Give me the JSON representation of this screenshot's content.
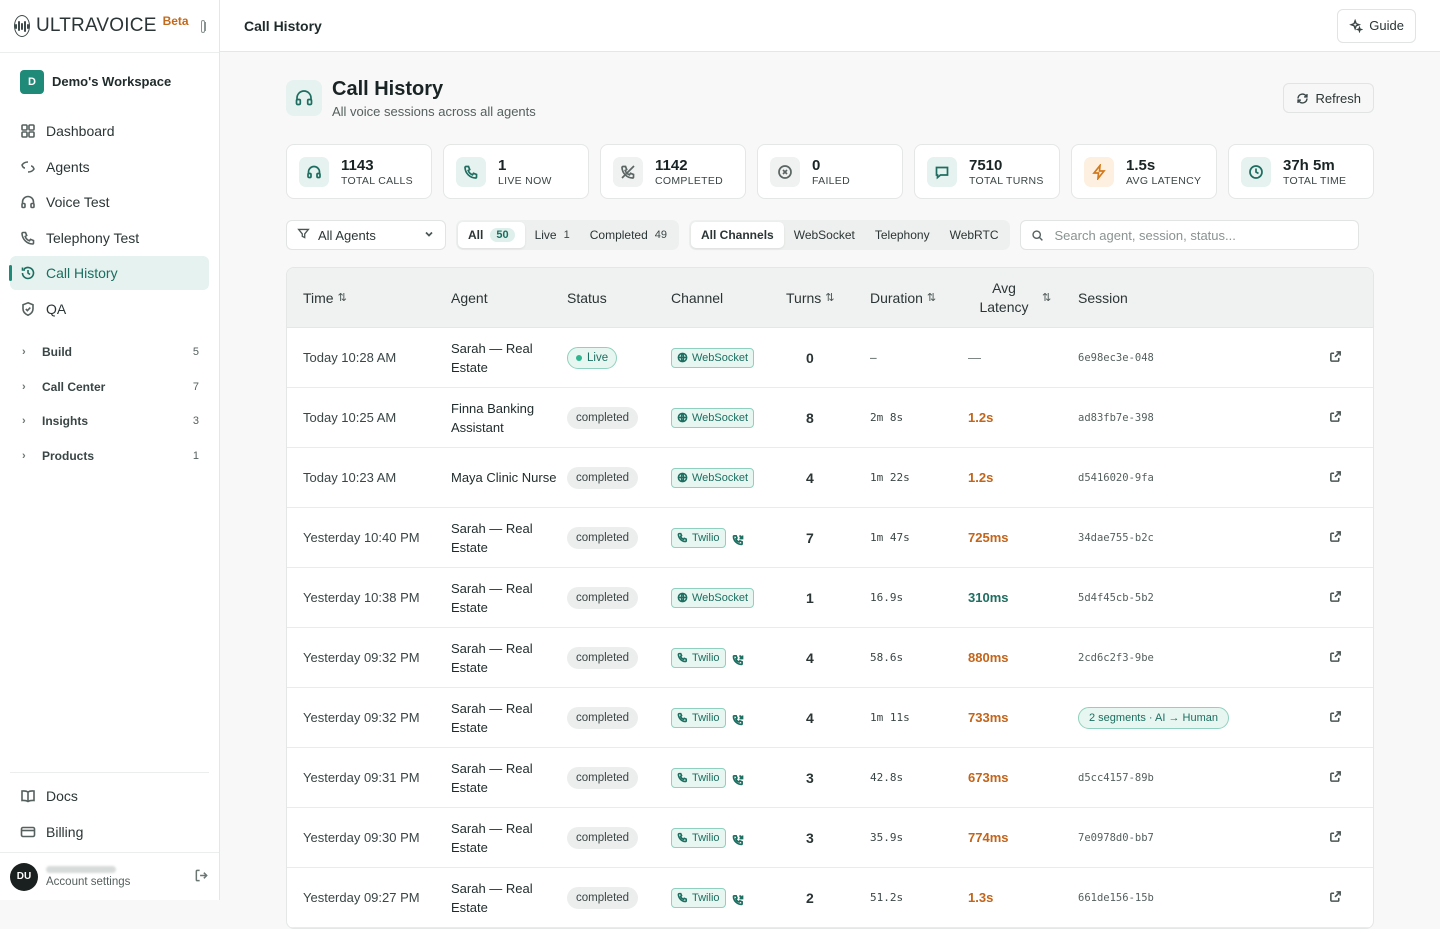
{
  "brand": {
    "name": "ULTRAVOICE",
    "badge": "Beta"
  },
  "workspace": {
    "initial": "D",
    "name": "Demo's Workspace"
  },
  "nav": [
    {
      "label": "Dashboard",
      "icon": "dashboard-icon"
    },
    {
      "label": "Agents",
      "icon": "agents-icon"
    },
    {
      "label": "Voice Test",
      "icon": "headphones-icon"
    },
    {
      "label": "Telephony Test",
      "icon": "phone-icon"
    },
    {
      "label": "Call History",
      "icon": "history-icon",
      "active": true
    },
    {
      "label": "QA",
      "icon": "shield-icon"
    }
  ],
  "groups": [
    {
      "label": "Build",
      "count": "5"
    },
    {
      "label": "Call Center",
      "count": "7"
    },
    {
      "label": "Insights",
      "count": "3"
    },
    {
      "label": "Products",
      "count": "1"
    }
  ],
  "bottom_nav": [
    {
      "label": "Docs",
      "icon": "book-icon"
    },
    {
      "label": "Billing",
      "icon": "card-icon"
    }
  ],
  "user": {
    "initials": "DU",
    "sub": "Account settings"
  },
  "topbar": {
    "title": "Call History",
    "guide_label": "Guide"
  },
  "header": {
    "title": "Call History",
    "subtitle": "All voice sessions across all agents",
    "refresh_label": "Refresh"
  },
  "stats": [
    {
      "value": "1143",
      "label": "TOTAL CALLS",
      "icon": "headphones-icon",
      "tone": "teal"
    },
    {
      "value": "1",
      "label": "LIVE NOW",
      "icon": "phone-icon",
      "tone": "teal"
    },
    {
      "value": "1142",
      "label": "COMPLETED",
      "icon": "phone-off-icon",
      "tone": "grey"
    },
    {
      "value": "0",
      "label": "FAILED",
      "icon": "x-circle-icon",
      "tone": "grey"
    },
    {
      "value": "7510",
      "label": "TOTAL TURNS",
      "icon": "message-icon",
      "tone": "teal"
    },
    {
      "value": "1.5s",
      "label": "AVG LATENCY",
      "icon": "zap-icon",
      "tone": "orange"
    },
    {
      "value": "37h 5m",
      "label": "TOTAL TIME",
      "icon": "clock-icon",
      "tone": "teal"
    }
  ],
  "filters": {
    "agent_select": "All Agents",
    "status_tabs": [
      {
        "label": "All",
        "count": "50",
        "active": true
      },
      {
        "label": "Live",
        "count": "1"
      },
      {
        "label": "Completed",
        "count": "49"
      }
    ],
    "channel_tabs": [
      {
        "label": "All Channels",
        "active": true
      },
      {
        "label": "WebSocket"
      },
      {
        "label": "Telephony"
      },
      {
        "label": "WebRTC"
      }
    ],
    "search_placeholder": "Search agent, session, status..."
  },
  "table": {
    "columns": {
      "time": "Time",
      "agent": "Agent",
      "status": "Status",
      "channel": "Channel",
      "turns": "Turns",
      "duration": "Duration",
      "latency": "Avg Latency",
      "session": "Session"
    },
    "sort_glyph": "⇅",
    "rows": [
      {
        "time": "Today 10:28 AM",
        "agent": "Sarah — Real Estate",
        "status": "Live",
        "live": true,
        "channel": "WebSocket",
        "turns": "0",
        "duration": "–",
        "latency": "—",
        "latency_tone": "none",
        "session": "6e98ec3e-048"
      },
      {
        "time": "Today 10:25 AM",
        "agent": "Finna Banking Assistant",
        "status": "completed",
        "channel": "WebSocket",
        "turns": "8",
        "duration": "2m 8s",
        "latency": "1.2s",
        "latency_tone": "slow",
        "session": "ad83fb7e-398"
      },
      {
        "time": "Today 10:23 AM",
        "agent": "Maya Clinic Nurse",
        "status": "completed",
        "channel": "WebSocket",
        "turns": "4",
        "duration": "1m 22s",
        "latency": "1.2s",
        "latency_tone": "slow",
        "session": "d5416020-9fa"
      },
      {
        "time": "Yesterday 10:40 PM",
        "agent": "Sarah — Real Estate",
        "status": "completed",
        "channel": "Twilio",
        "turns": "7",
        "duration": "1m 47s",
        "latency": "725ms",
        "latency_tone": "slow",
        "session": "34dae755-b2c"
      },
      {
        "time": "Yesterday 10:38 PM",
        "agent": "Sarah — Real Estate",
        "status": "completed",
        "channel": "WebSocket",
        "turns": "1",
        "duration": "16.9s",
        "latency": "310ms",
        "latency_tone": "fast",
        "session": "5d4f45cb-5b2"
      },
      {
        "time": "Yesterday 09:32 PM",
        "agent": "Sarah — Real Estate",
        "status": "completed",
        "channel": "Twilio",
        "turns": "4",
        "duration": "58.6s",
        "latency": "880ms",
        "latency_tone": "slow",
        "session": "2cd6c2f3-9be"
      },
      {
        "time": "Yesterday 09:32 PM",
        "agent": "Sarah — Real Estate",
        "status": "completed",
        "channel": "Twilio",
        "turns": "4",
        "duration": "1m 11s",
        "latency": "733ms",
        "latency_tone": "slow",
        "session": "2 segments · AI → Human",
        "segments": true
      },
      {
        "time": "Yesterday 09:31 PM",
        "agent": "Sarah — Real Estate",
        "status": "completed",
        "channel": "Twilio",
        "turns": "3",
        "duration": "42.8s",
        "latency": "673ms",
        "latency_tone": "slow",
        "session": "d5cc4157-89b"
      },
      {
        "time": "Yesterday 09:30 PM",
        "agent": "Sarah — Real Estate",
        "status": "completed",
        "channel": "Twilio",
        "turns": "3",
        "duration": "35.9s",
        "latency": "774ms",
        "latency_tone": "slow",
        "session": "7e0978d0-bb7"
      },
      {
        "time": "Yesterday 09:27 PM",
        "agent": "Sarah — Real Estate",
        "status": "completed",
        "channel": "Twilio",
        "turns": "2",
        "duration": "51.2s",
        "latency": "1.3s",
        "latency_tone": "slow",
        "session": "661de156-15b"
      }
    ]
  },
  "colors": {
    "accent": "#1f8a78",
    "latency_slow": "#c2641a",
    "latency_fast": "#1f6d60"
  }
}
